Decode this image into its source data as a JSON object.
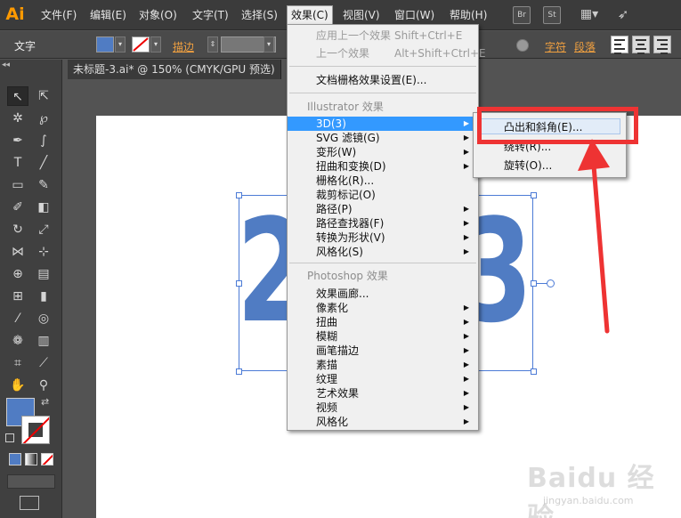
{
  "app": {
    "logo": "Ai"
  },
  "menubar": {
    "items": [
      "文件(F)",
      "编辑(E)",
      "对象(O)",
      "文字(T)",
      "选择(S)",
      "效果(C)",
      "视图(V)",
      "窗口(W)",
      "帮助(H)"
    ],
    "active": "效果(C)",
    "tool_icons": [
      "Br",
      "St"
    ]
  },
  "control_bar": {
    "label": "文字",
    "stroke_label": "描边",
    "char_label": "字符",
    "para_label": "段落"
  },
  "document": {
    "tab_title": "未标题-3.ai* @ 150% (CMYK/GPU 预选)"
  },
  "canvas": {
    "digit_left": "2",
    "digit_right": "3",
    "text_color": "#507cc3"
  },
  "effect_menu": {
    "apply_last": {
      "label": "应用上一个效果",
      "shortcut": "Shift+Ctrl+E"
    },
    "last_effect": {
      "label": "上一个效果",
      "shortcut": "Alt+Shift+Ctrl+E"
    },
    "doc_raster": "文档栅格效果设置(E)...",
    "illustrator_header": "Illustrator 效果",
    "illustrator_items": [
      "3D(3)",
      "SVG 滤镜(G)",
      "变形(W)",
      "扭曲和变换(D)",
      "栅格化(R)...",
      "裁剪标记(O)",
      "路径(P)",
      "路径查找器(F)",
      "转换为形状(V)",
      "风格化(S)"
    ],
    "photoshop_header": "Photoshop 效果",
    "photoshop_items": [
      "效果画廊...",
      "像素化",
      "扭曲",
      "模糊",
      "画笔描边",
      "素描",
      "纹理",
      "艺术效果",
      "视频",
      "风格化"
    ]
  },
  "submenu_3d": {
    "items": [
      "凸出和斜角(E)...",
      "绕转(R)...",
      "旋转(O)..."
    ],
    "hovered": "凸出和斜角(E)..."
  },
  "annotation": {
    "color": "#ee3333"
  },
  "watermark": {
    "main": "Baidu 经验",
    "sub": "jingyan.baidu.com"
  },
  "colors": {
    "fill_swatch": "#507cc3",
    "menu_highlight": "#3399ff"
  }
}
